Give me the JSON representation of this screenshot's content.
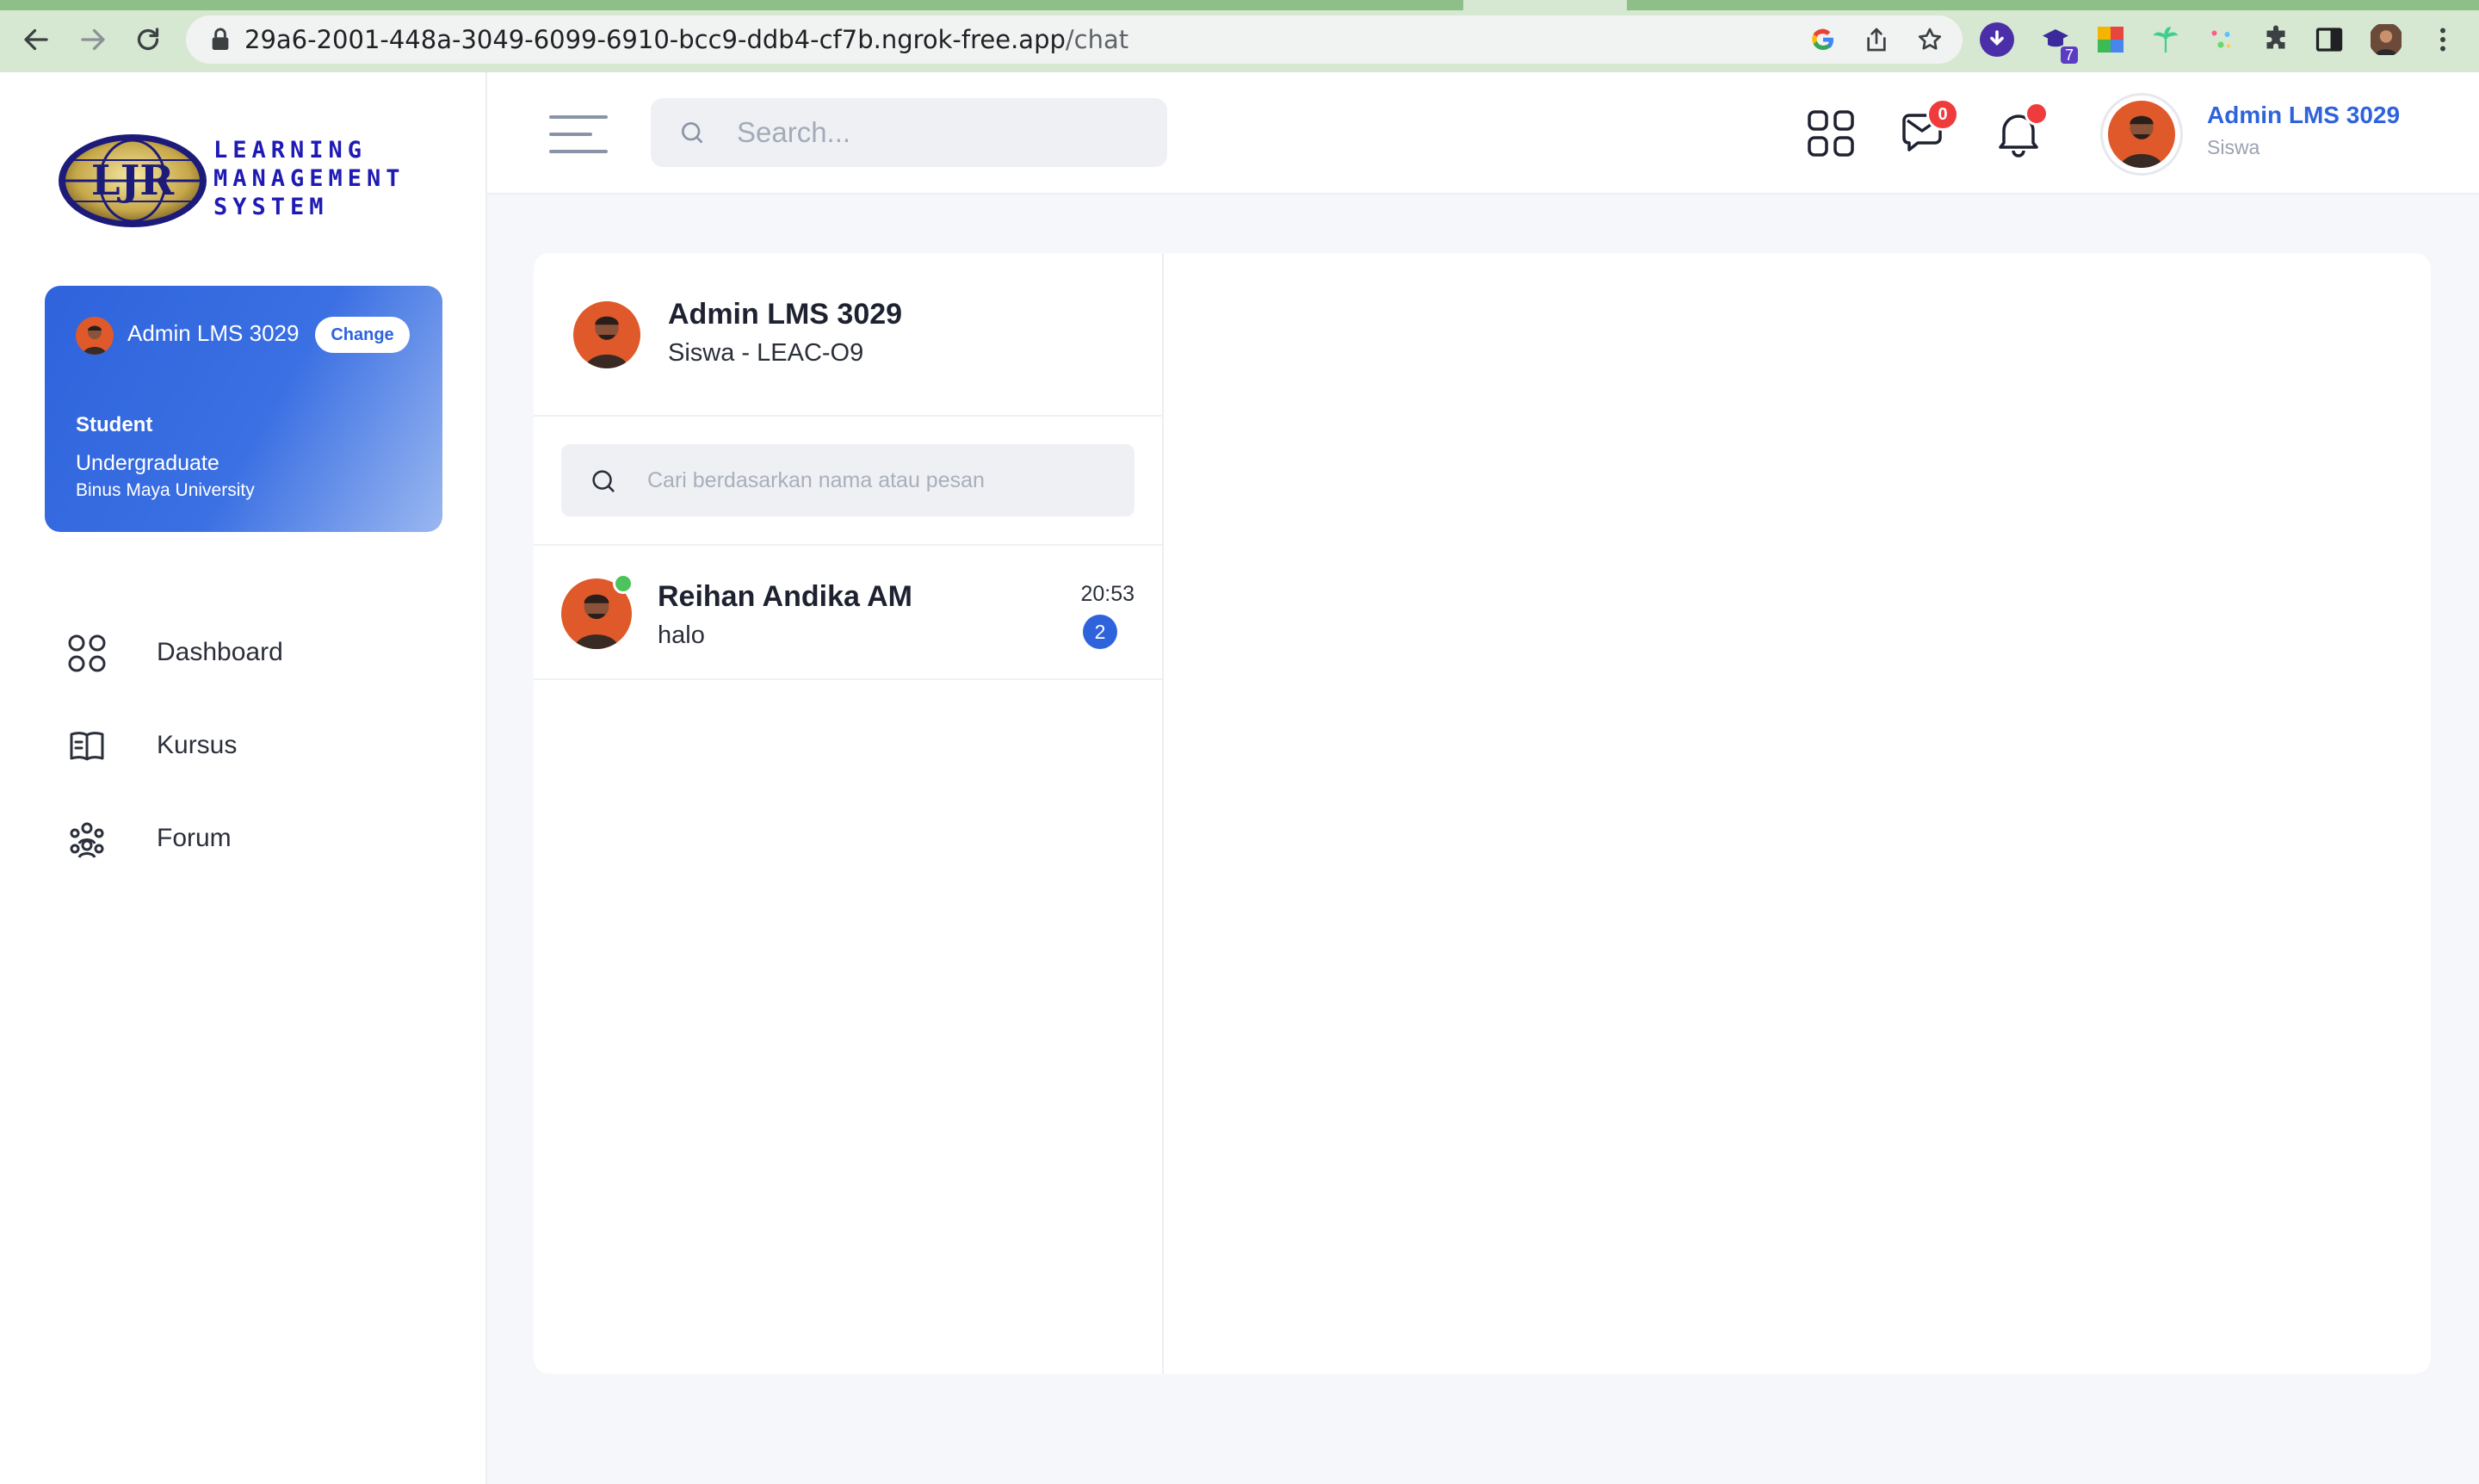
{
  "browser": {
    "url_host": "29a6-2001-448a-3049-6099-6910-bcc9-ddb4-cf7b.ngrok-free.app",
    "url_path": "/chat",
    "extension_badge": "7"
  },
  "sidebar": {
    "logo_lines": [
      "LEARNING",
      "MANAGEMENT",
      "SYSTEM"
    ],
    "logo_monogram": "LJR",
    "user_card": {
      "name": "Admin LMS 3029",
      "change_label": "Change",
      "role": "Student",
      "degree": "Undergraduate",
      "university": "Binus Maya University"
    },
    "nav": [
      {
        "label": "Dashboard",
        "icon": "grid-icon"
      },
      {
        "label": "Kursus",
        "icon": "book-icon"
      },
      {
        "label": "Forum",
        "icon": "users-icon"
      }
    ]
  },
  "topbar": {
    "search_placeholder": "Search...",
    "messages_count": "0",
    "user_name": "Admin LMS 3029",
    "user_role": "Siswa"
  },
  "chat": {
    "me": {
      "name": "Admin LMS 3029",
      "subtitle": "Siswa - LEAC-O9"
    },
    "search_placeholder": "Cari berdasarkan nama atau pesan",
    "conversations": [
      {
        "name": "Reihan Andika AM",
        "last_message": "halo",
        "time": "20:53",
        "unread": "2",
        "online": true
      }
    ]
  },
  "colors": {
    "accent": "#2e63dc",
    "badge": "#ef3b3b",
    "online": "#4cc35c",
    "logo_text": "#1f1ab4"
  }
}
